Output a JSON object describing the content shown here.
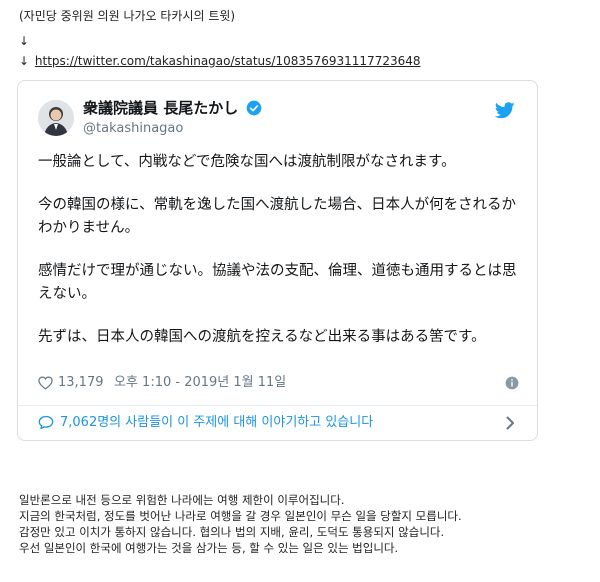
{
  "post": {
    "intro": "(자민당 중위원 의원 나가오 타카시의 트윗)",
    "arrow": "↓",
    "link_arrow": "↓",
    "tweet_url": "https://twitter.com/takashinagao/status/1083576931117723648"
  },
  "tweet": {
    "author_name": "衆議院議員 長尾たかし",
    "author_handle": "@takashinagao",
    "paragraphs": [
      "一般論として、内戦などで危険な国へは渡航制限がなされます。",
      "今の韓国の様に、常軌を逸した国へ渡航した場合、日本人が何をされるかわかりません。",
      "感情だけで理が通じない。協議や法の支配、倫理、道徳も通用するとは思えない。",
      "先ずは、日本人の韓国への渡航を控えるなど出来る事はある筈です。"
    ],
    "like_count": "13,179",
    "timestamp": "오후 1:10 - 2019년 1월 11일",
    "conversation": "7,062명의 사람들이 이 주제에 대해 이야기하고 있습니다",
    "icons": {
      "verified": "verified-badge-icon",
      "bird": "twitter-bird-icon",
      "heart": "heart-icon",
      "info": "info-icon",
      "bubble": "comment-bubble-icon",
      "chevron": "chevron-right-icon"
    },
    "colors": {
      "brand_blue": "#1da1f2",
      "link_blue": "#1b95e0",
      "muted_gray": "#657786"
    }
  },
  "translation": {
    "lines": [
      "일반론으로 내전 등으로 위험한 나라에는 여행 제한이 이루어집니다.",
      "지금의 한국처럼, 정도를 벗어난 나라로 여행을 갈 경우 일본인이 무슨 일을 당할지 모릅니다.",
      "감정만 있고 이치가 통하지 않습니다. 협의나 법의 지배, 윤리, 도덕도 통용되지 않습니다.",
      "우선 일본인이 한국에 여행가는 것을 삼가는 등, 할 수 있는 일은 있는 법입니다."
    ]
  }
}
